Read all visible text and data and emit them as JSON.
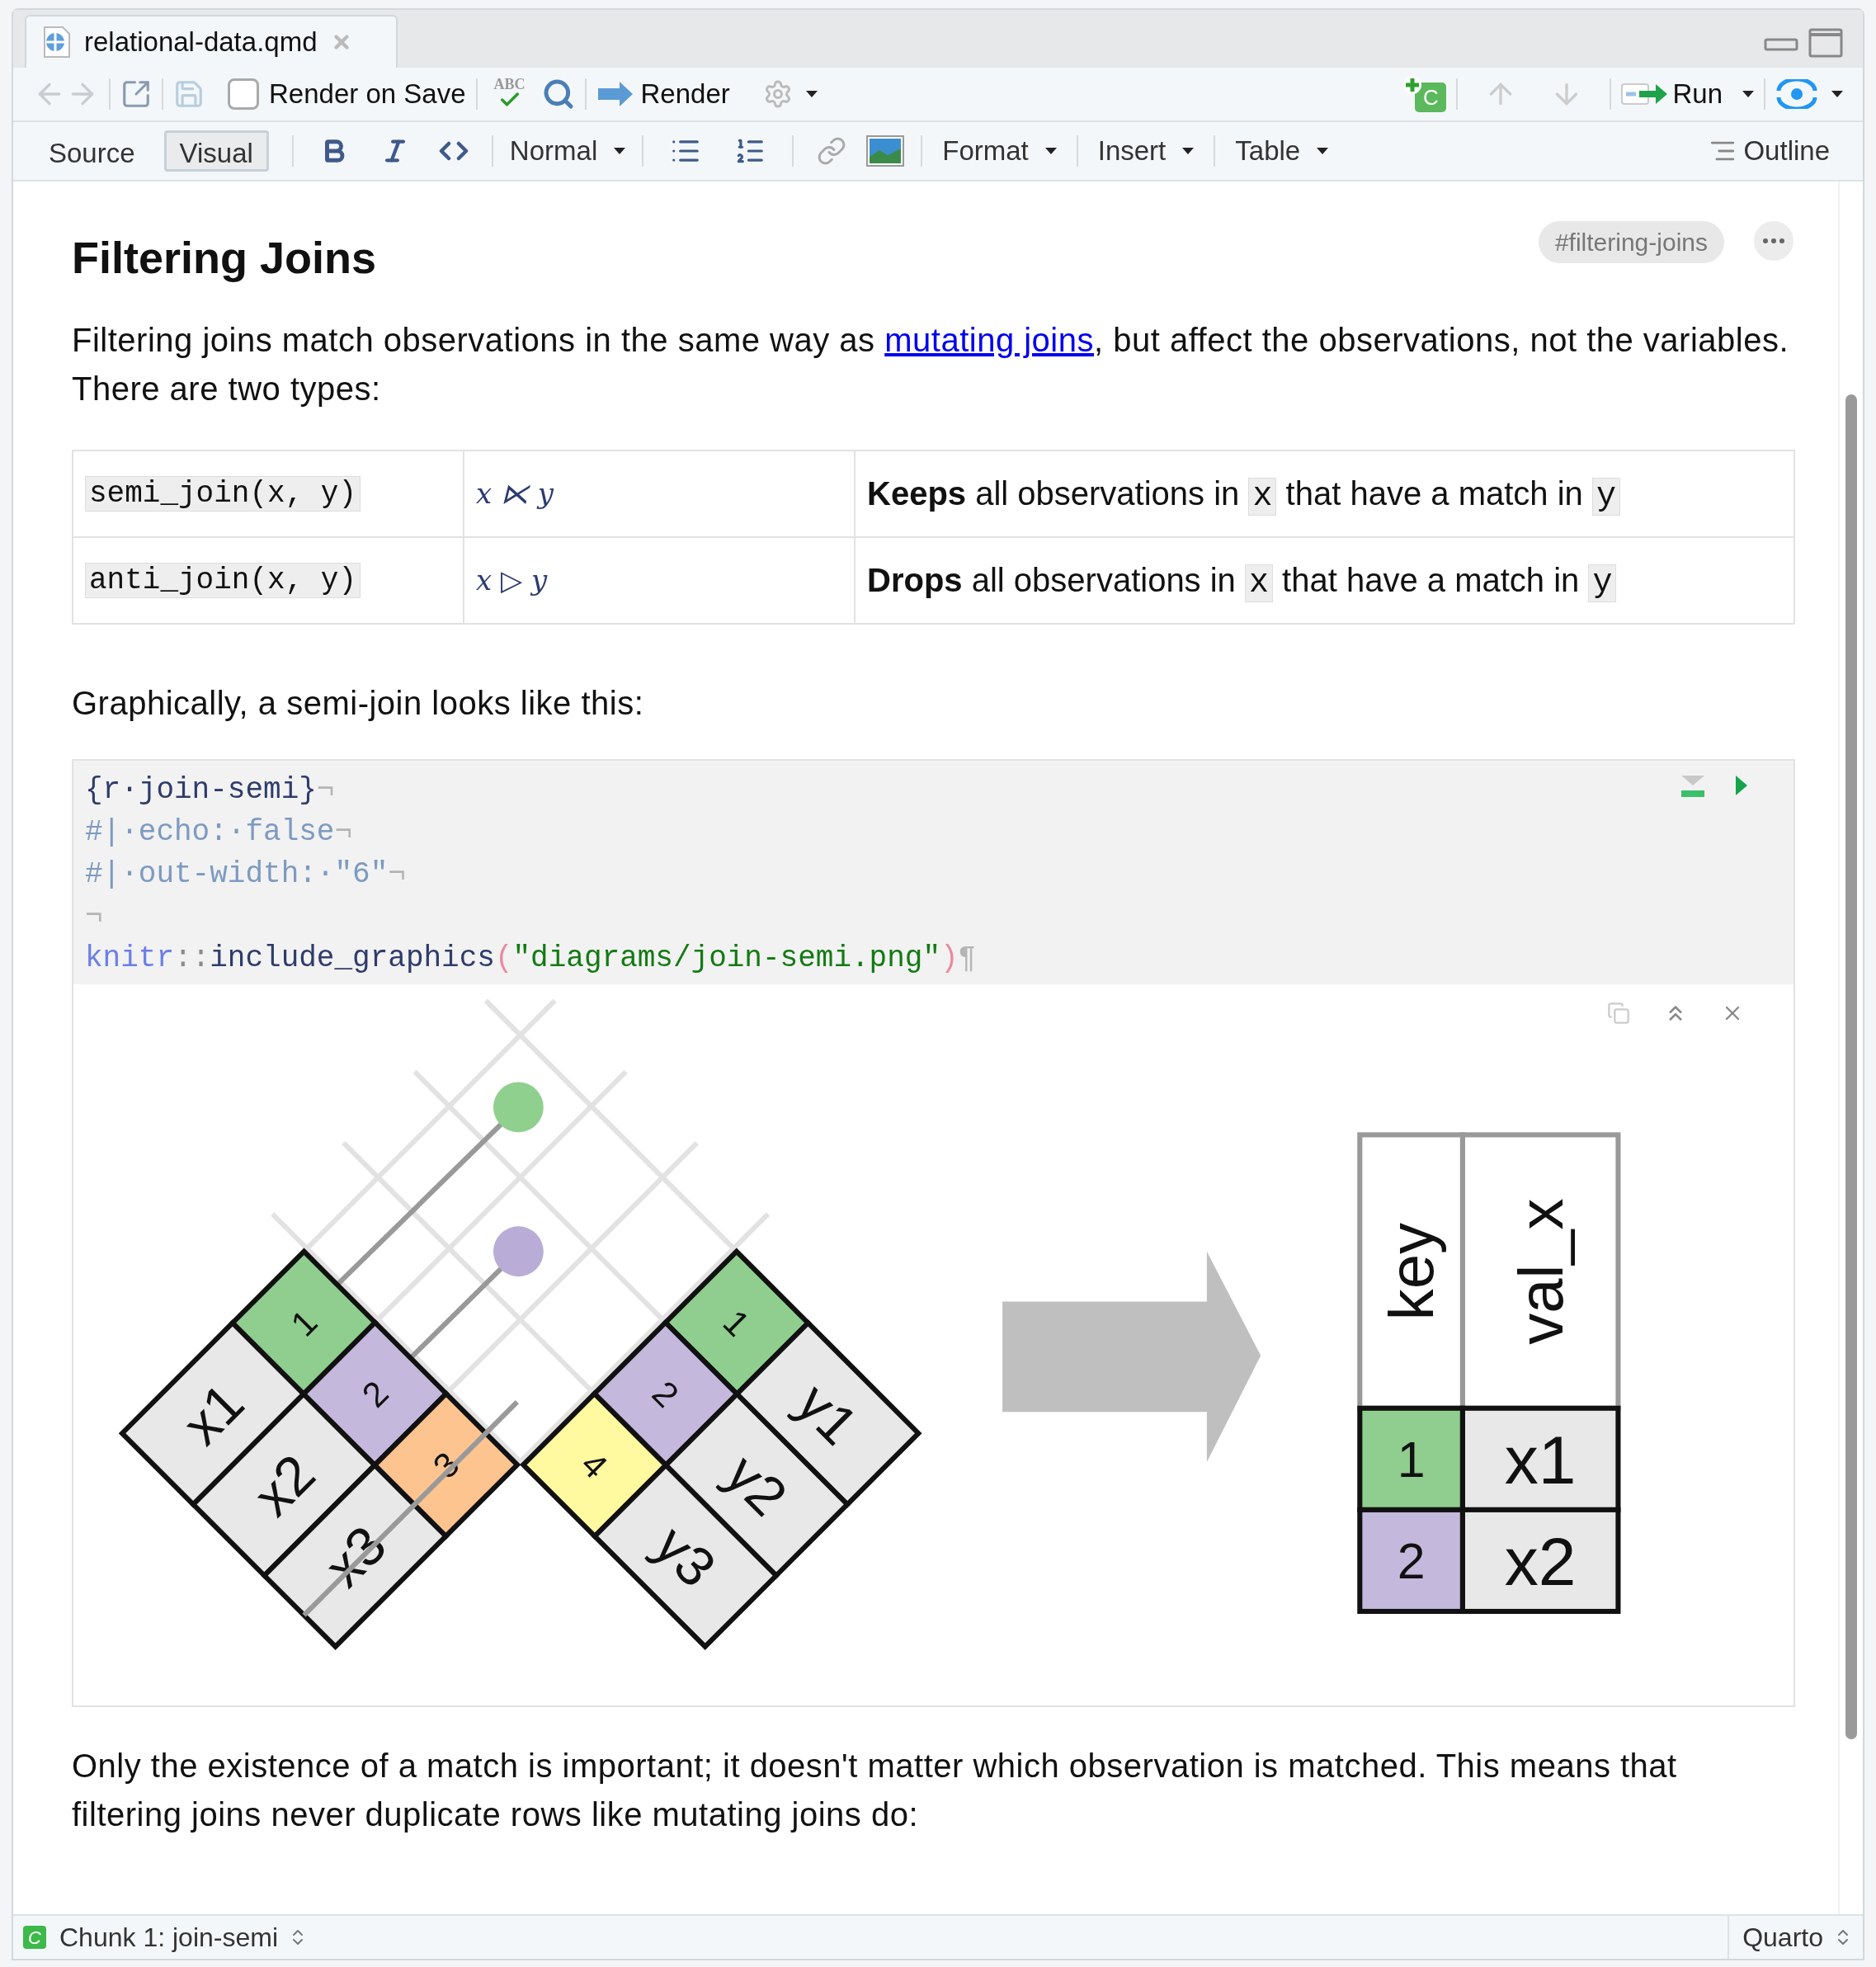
{
  "tab": {
    "title": "relational-data.qmd"
  },
  "toolbar": {
    "render_on_save": {
      "label": "Render on Save",
      "checked": false
    },
    "spellcheck_label": "ABC",
    "render": "Render",
    "chunk_badge": "C",
    "run": "Run"
  },
  "format_bar": {
    "modes": [
      {
        "label": "Source",
        "selected": false
      },
      {
        "label": "Visual",
        "selected": true
      }
    ],
    "style": "Normal",
    "menus": [
      "Format",
      "Insert",
      "Table"
    ],
    "outline": "Outline"
  },
  "section": {
    "heading": "Filtering Joins",
    "anchor": "#filtering-joins"
  },
  "intro": [
    {
      "kind": "text",
      "text": "Filtering joins match observations in the same way as "
    },
    {
      "kind": "link",
      "text": "mutating joins"
    },
    {
      "kind": "text",
      "text": ", but affect the observations, not the variables. There are two types:"
    }
  ],
  "join_table": {
    "rows": [
      {
        "function": "semi_join(x, y)",
        "math": "x ⋉ y",
        "description": [
          {
            "kind": "bold",
            "text": "Keeps"
          },
          {
            "kind": "text",
            "text": " all observations in "
          },
          {
            "kind": "code",
            "text": "x"
          },
          {
            "kind": "text",
            "text": " that have a match in "
          },
          {
            "kind": "code",
            "text": "y"
          }
        ]
      },
      {
        "function": "anti_join(x, y)",
        "math": "x ▷ y",
        "description": [
          {
            "kind": "bold",
            "text": "Drops"
          },
          {
            "kind": "text",
            "text": " all observations in "
          },
          {
            "kind": "code",
            "text": "x"
          },
          {
            "kind": "text",
            "text": " that have a match in "
          },
          {
            "kind": "code",
            "text": "y"
          }
        ]
      }
    ]
  },
  "graphically": "Graphically, a semi-join looks like this:",
  "code_chunk": {
    "lines": [
      [
        {
          "kind": "meta",
          "text": "{r·join-semi}"
        },
        {
          "kind": "mark",
          "text": "¬"
        }
      ],
      [
        {
          "kind": "comment",
          "text": "#|·echo:·false"
        },
        {
          "kind": "mark",
          "text": "¬"
        }
      ],
      [
        {
          "kind": "comment",
          "text": "#|·out-width:·\"6\""
        },
        {
          "kind": "mark",
          "text": "¬"
        }
      ],
      [
        {
          "kind": "mark",
          "text": "¬"
        }
      ],
      [
        {
          "kind": "ns",
          "text": "knitr"
        },
        {
          "kind": "op",
          "text": "::"
        },
        {
          "kind": "fn",
          "text": "include_graphics"
        },
        {
          "kind": "paren",
          "text": "("
        },
        {
          "kind": "string",
          "text": "\"diagrams/join-semi.png\""
        },
        {
          "kind": "paren",
          "text": ")"
        },
        {
          "kind": "mark",
          "text": "¶"
        }
      ]
    ]
  },
  "diagram": {
    "left_table": {
      "keys": [
        {
          "label": "1",
          "color": "#8fce8e"
        },
        {
          "label": "2",
          "color": "#c5b8dd"
        },
        {
          "label": "3",
          "color": "#fdc48f"
        }
      ],
      "values": [
        "x1",
        "x2",
        "x3"
      ]
    },
    "right_table": {
      "keys": [
        {
          "label": "1",
          "color": "#8fce8e"
        },
        {
          "label": "2",
          "color": "#c5b8dd"
        },
        {
          "label": "4",
          "color": "#fff9a0"
        }
      ],
      "values": [
        "y1",
        "y2",
        "y3"
      ]
    },
    "matches": [
      {
        "color": "#90d08f"
      },
      {
        "color": "#b9acd6"
      }
    ],
    "result_table": {
      "columns": [
        "key",
        "val_x"
      ],
      "rows": [
        {
          "key": "1",
          "color": "#8fce8e",
          "value": "x1"
        },
        {
          "key": "2",
          "color": "#c5b8dd",
          "value": "x2"
        }
      ]
    }
  },
  "closing": "Only the existence of a match is important; it doesn't matter which observation is matched. This means that filtering joins never duplicate rows like mutating joins do:",
  "status_bar": {
    "chunk_badge": "C",
    "chunk": "Chunk 1: join-semi",
    "mode": "Quarto"
  }
}
